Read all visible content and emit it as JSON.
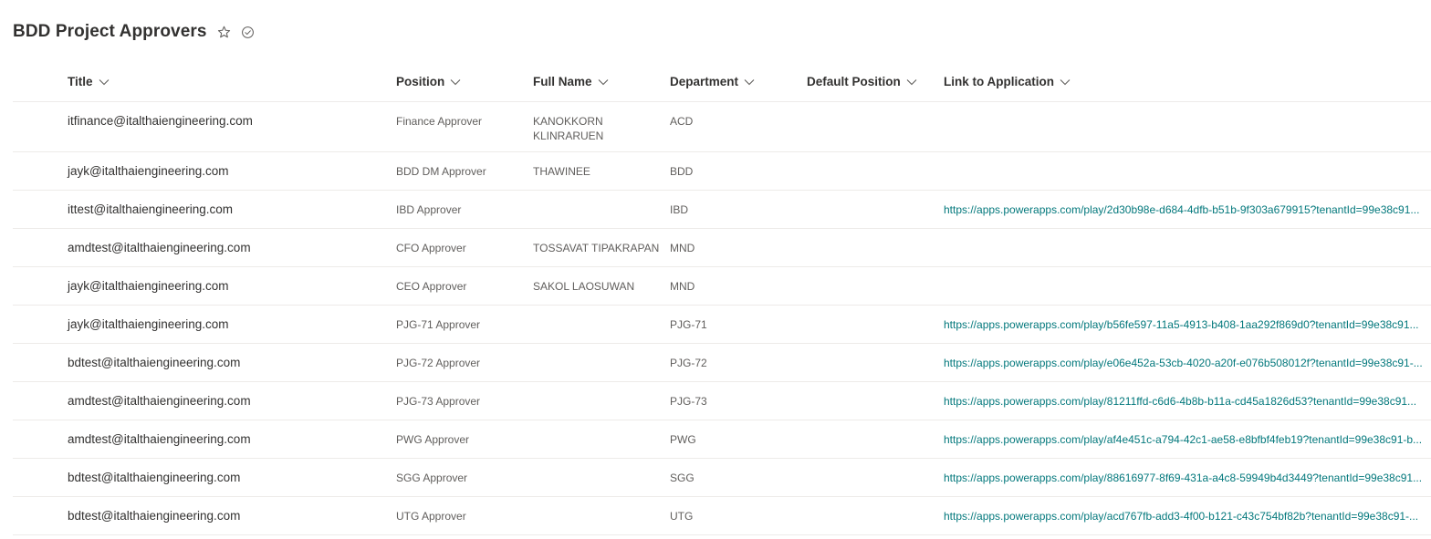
{
  "list": {
    "title": "BDD Project Approvers"
  },
  "icons": {
    "favorite": "star-outline-icon",
    "status": "check-circle-icon",
    "sort": "chevron-down-icon"
  },
  "colors": {
    "link": "#03787c",
    "text": "#323130",
    "subtext": "#605e5c",
    "divider": "#edebe9"
  },
  "columns": {
    "title": "Title",
    "position": "Position",
    "full_name": "Full Name",
    "department": "Department",
    "default_position": "Default Position",
    "link": "Link to Application"
  },
  "rows": [
    {
      "title": "itfinance@italthaiengineering.com",
      "position": "Finance Approver",
      "full_name": "KANOKKORN KLINRARUEN",
      "department": "ACD",
      "default_position": "",
      "link": ""
    },
    {
      "title": "jayk@italthaiengineering.com",
      "position": "BDD DM Approver",
      "full_name": "THAWINEE",
      "department": "BDD",
      "default_position": "",
      "link": ""
    },
    {
      "title": "ittest@italthaiengineering.com",
      "position": "IBD Approver",
      "full_name": "",
      "department": "IBD",
      "default_position": "",
      "link": "https://apps.powerapps.com/play/2d30b98e-d684-4dfb-b51b-9f303a679915?tenantId=99e38c91..."
    },
    {
      "title": "amdtest@italthaiengineering.com",
      "position": "CFO Approver",
      "full_name": "TOSSAVAT TIPAKRAPAN",
      "department": "MND",
      "default_position": "",
      "link": ""
    },
    {
      "title": "jayk@italthaiengineering.com",
      "position": "CEO Approver",
      "full_name": "SAKOL LAOSUWAN",
      "department": "MND",
      "default_position": "",
      "link": ""
    },
    {
      "title": "jayk@italthaiengineering.com",
      "position": "PJG-71 Approver",
      "full_name": "",
      "department": "PJG-71",
      "default_position": "",
      "link": "https://apps.powerapps.com/play/b56fe597-11a5-4913-b408-1aa292f869d0?tenantId=99e38c91..."
    },
    {
      "title": "bdtest@italthaiengineering.com",
      "position": "PJG-72 Approver",
      "full_name": "",
      "department": "PJG-72",
      "default_position": "",
      "link": "https://apps.powerapps.com/play/e06e452a-53cb-4020-a20f-e076b508012f?tenantId=99e38c91-..."
    },
    {
      "title": "amdtest@italthaiengineering.com",
      "position": "PJG-73 Approver",
      "full_name": "",
      "department": "PJG-73",
      "default_position": "",
      "link": "https://apps.powerapps.com/play/81211ffd-c6d6-4b8b-b11a-cd45a1826d53?tenantId=99e38c91..."
    },
    {
      "title": "amdtest@italthaiengineering.com",
      "position": "PWG Approver",
      "full_name": "",
      "department": "PWG",
      "default_position": "",
      "link": "https://apps.powerapps.com/play/af4e451c-a794-42c1-ae58-e8bfbf4feb19?tenantId=99e38c91-b..."
    },
    {
      "title": "bdtest@italthaiengineering.com",
      "position": "SGG Approver",
      "full_name": "",
      "department": "SGG",
      "default_position": "",
      "link": "https://apps.powerapps.com/play/88616977-8f69-431a-a4c8-59949b4d3449?tenantId=99e38c91..."
    },
    {
      "title": "bdtest@italthaiengineering.com",
      "position": "UTG Approver",
      "full_name": "",
      "department": "UTG",
      "default_position": "",
      "link": "https://apps.powerapps.com/play/acd767fb-add3-4f00-b121-c43c754bf82b?tenantId=99e38c91-..."
    }
  ]
}
